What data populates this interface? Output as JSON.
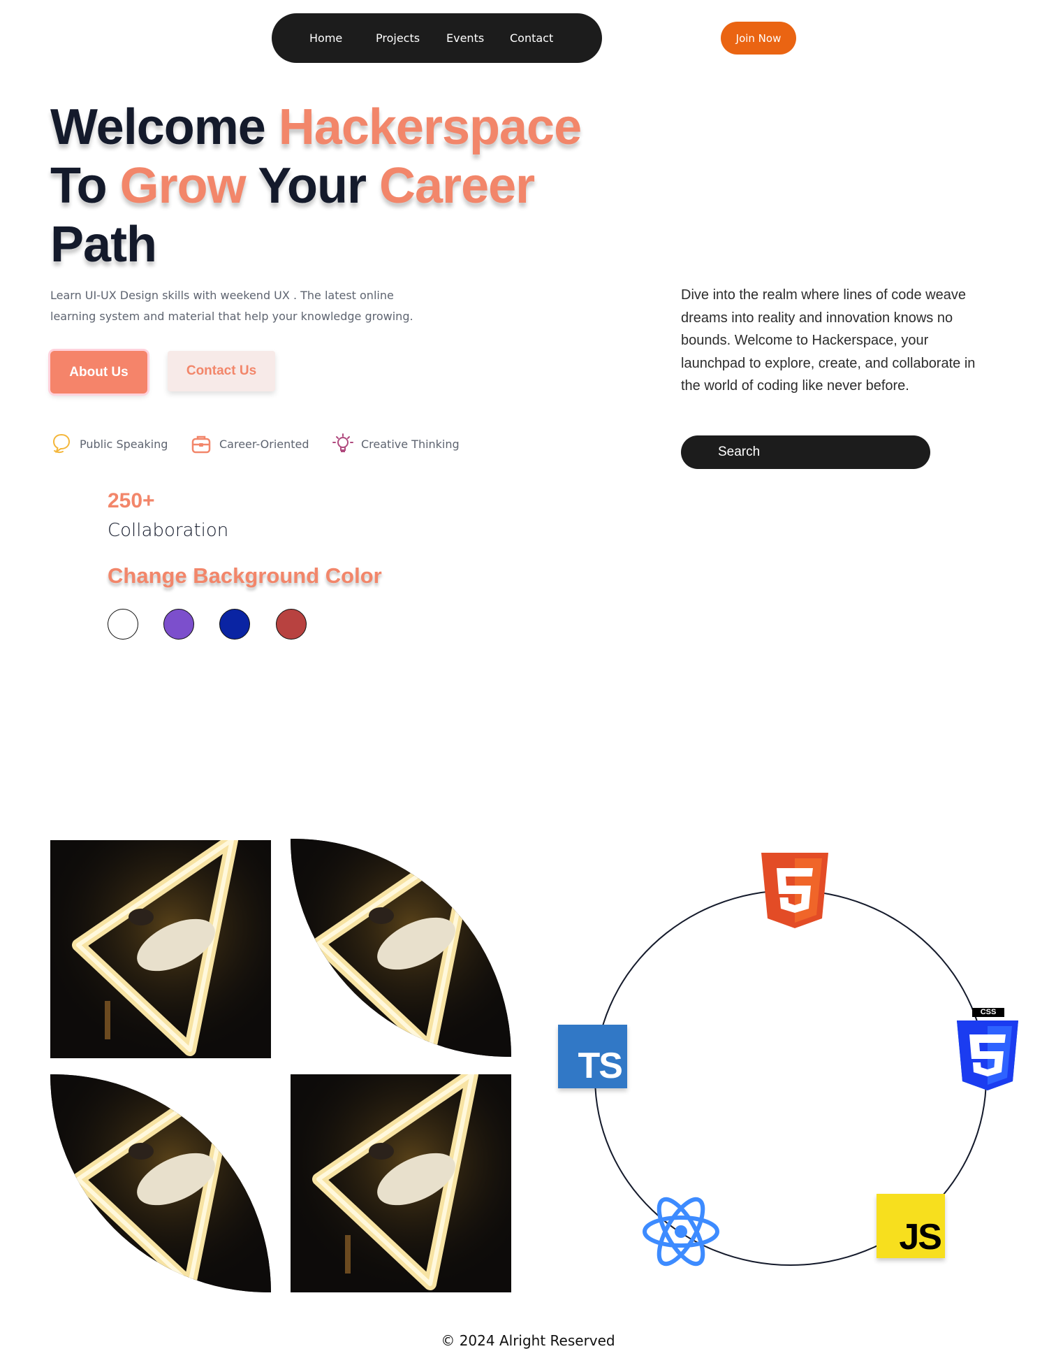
{
  "nav": {
    "items": [
      {
        "label": "Home"
      },
      {
        "label": "Projects"
      },
      {
        "label": "Events"
      },
      {
        "label": "Contact"
      }
    ],
    "join_label": "Join Now"
  },
  "hero": {
    "title_line1_a": "Welcome ",
    "title_line1_b": "Hackerspace",
    "title_line2_a": "To ",
    "title_line2_b": "Grow",
    "title_line2_c": " Your ",
    "title_line2_d": "Career",
    "title_line3": "Path",
    "lead": "Learn UI-UX Design skills with weekend UX . The latest online learning system and material that help your knowledge growing.",
    "about_label": "About Us",
    "contact_label": "Contact Us"
  },
  "skills": [
    {
      "label": "Public Speaking",
      "icon": "speech-bubble-icon"
    },
    {
      "label": "Career-Oriented",
      "icon": "briefcase-icon"
    },
    {
      "label": "Creative Thinking",
      "icon": "lightbulb-icon"
    }
  ],
  "stats": {
    "number": "250+",
    "label": "Collaboration"
  },
  "background_picker": {
    "title": "Change Background Color",
    "colors": [
      "#ffffff",
      "#7c4fcc",
      "#0a24a3",
      "#b84240"
    ]
  },
  "intro": {
    "text": "Dive into the realm where lines of code weave dreams into reality and innovation knows no bounds. Welcome to Hackerspace, your launchpad to explore, create, and collaborate in the world of coding like never before."
  },
  "search": {
    "label": "Search"
  },
  "tech_stack": {
    "html_icon": "html5-icon",
    "css_icon": "css3-icon",
    "css_tag": "CSS",
    "ts_label": "TS",
    "js_label": "JS",
    "react_icon": "react-icon"
  },
  "colors": {
    "accent": "#f2866a",
    "join": "#ea6412",
    "dark": "#1c1c1c",
    "text": "#141a2b"
  },
  "footer": {
    "text": "© 2024 Alright Reserved"
  }
}
